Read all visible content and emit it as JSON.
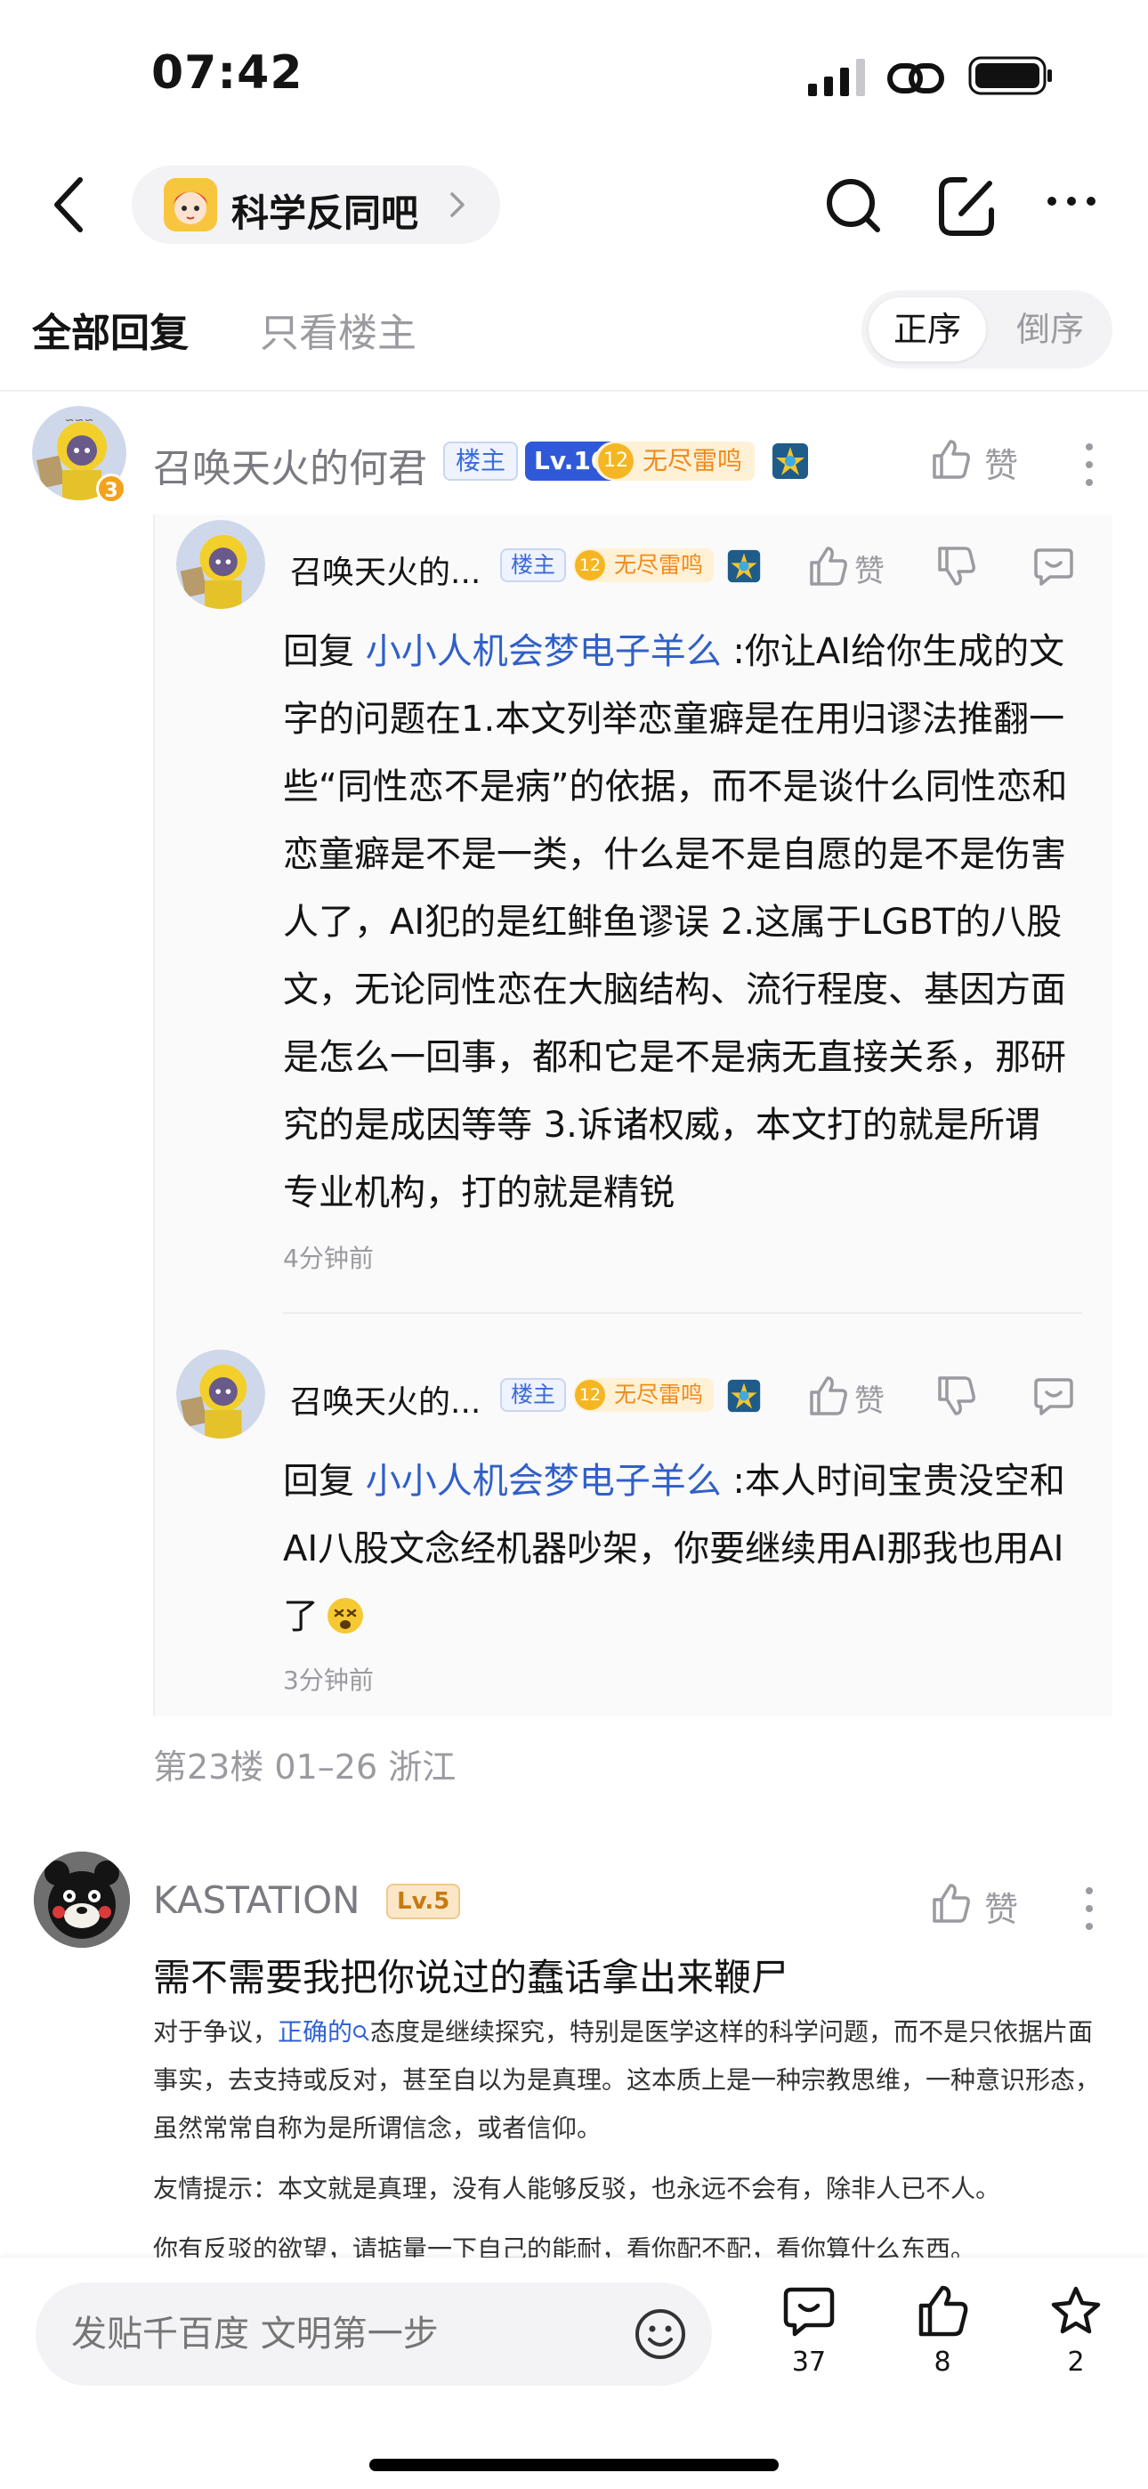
{
  "status_bar": {
    "time": "07:42"
  },
  "nav": {
    "forum_name": "科学反同吧"
  },
  "tabs": {
    "all": "全部回复",
    "op_only": "只看楼主"
  },
  "sort": {
    "asc": "正序",
    "desc": "倒序"
  },
  "floor": {
    "author": "召唤天火的何君",
    "avatar_level": "3",
    "host_badge": "楼主",
    "level_badge": "Lv.10",
    "title_level": "12",
    "title_badge": "无尽雷鸣",
    "like_label": "赞",
    "meta": "第23楼 01–26 浙江",
    "replies": [
      {
        "author": "召唤天火的...",
        "host_badge": "楼主",
        "title_level": "12",
        "title_badge": "无尽雷鸣",
        "like_label": "赞",
        "reply_prefix": "回复 ",
        "mention": "小小人机会梦电子羊么",
        "text": " :你让AI给你生成的文字的问题在1.本文列举恋童癖是在用归谬法推翻一些“同性恋不是病”的依据，而不是谈什么同性恋和恋童癖是不是一类，什么是不是自愿的是不是伤害人了，AI犯的是红鲱鱼谬误 2.这属于LGBT的八股文，无论同性恋在大脑结构、流行程度、基因方面是怎么一回事，都和它是不是病无直接关系，那研究的是成因等等 3.诉诸权威，本文打的就是所谓专业机构，打的就是精锐",
        "time": "4分钟前"
      },
      {
        "author": "召唤天火的...",
        "host_badge": "楼主",
        "title_level": "12",
        "title_badge": "无尽雷鸣",
        "like_label": "赞",
        "reply_prefix": "回复 ",
        "mention": "小小人机会梦电子羊么",
        "text": " :本人时间宝贵没空和AI八股文念经机器吵架，你要继续用AI那我也用AI了",
        "time": "3分钟前"
      }
    ]
  },
  "post2": {
    "author": "KASTATION",
    "level_badge": "Lv.5",
    "like_label": "赞",
    "title": "需不需要我把你说过的蠢话拿出来鞭尸",
    "quote_p1_start": "对于争议，",
    "quote_p1_link": "正确的",
    "quote_p1_rest": "态度是继续探究，特别是医学这样的科学问题，而不是只依据片面事实，去支持或反对，甚至自以为是真理。这本质上是一种宗教思维，一种意识形态，虽然常常自称为是所谓信念，或者信仰。",
    "quote_p2": "友情提示：本文就是真理，没有人能够反驳，也永远不会有，除非人已不人。",
    "quote_p3": "你有反驳的欲望，请掂量一下自己的能耐，看你配不配，看你算什么东西。"
  },
  "bottom_bar": {
    "input_placeholder": "发贴千百度 文明第一步",
    "comment_count": "37",
    "like_count": "8",
    "favorite_count": "2"
  }
}
